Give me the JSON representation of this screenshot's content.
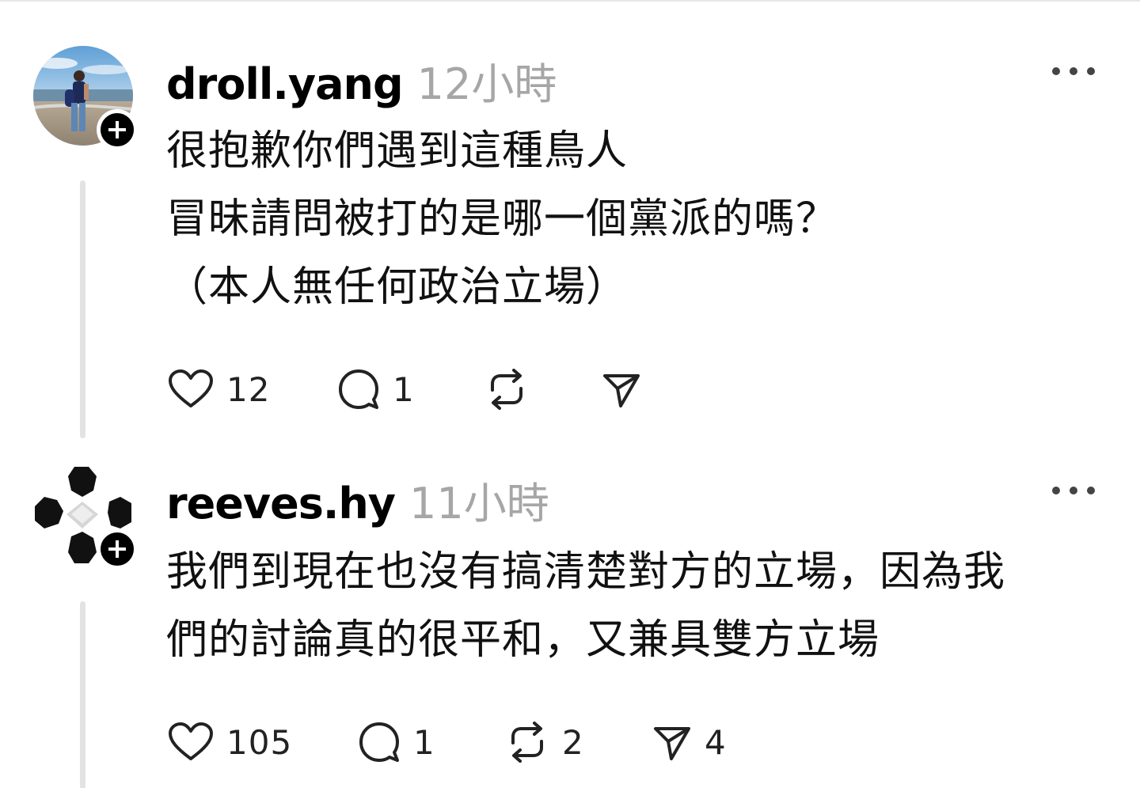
{
  "posts": [
    {
      "username": "droll.yang",
      "time": "12小時",
      "lines": [
        "很抱歉你們遇到這種鳥人",
        "冒昧請問被打的是哪一個黨派的嗎？",
        "（本人無任何政治立場）"
      ],
      "likes": "12",
      "comments": "1",
      "reposts": "",
      "shares": "",
      "avatar_icon": "person-on-beach-avatar",
      "more_icon": "more-horizontal-icon"
    },
    {
      "username": "reeves.hy",
      "time": "11小時",
      "lines": [
        "我們到現在也沒有搞清楚對方的立場，因為我",
        "們的討論真的很平和，又兼具雙方立場"
      ],
      "likes": "105",
      "comments": "1",
      "reposts": "2",
      "shares": "4",
      "avatar_icon": "pixel-diamond-avatar",
      "more_icon": "more-horizontal-icon"
    }
  ],
  "colors": {
    "text": "#000000",
    "muted": "#a6a6a6",
    "thread_line": "#e3e3e3",
    "badge": "#000000"
  }
}
